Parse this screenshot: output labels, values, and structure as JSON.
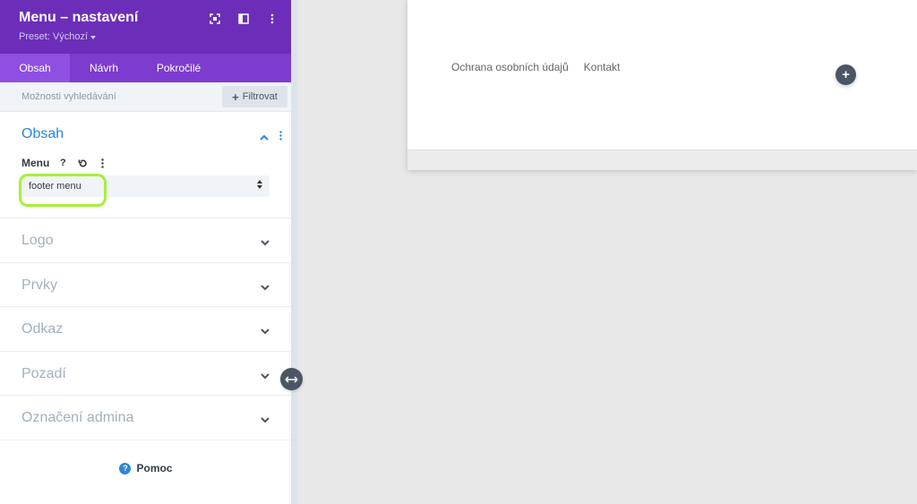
{
  "panel": {
    "title": "Menu – nastavení",
    "preset": "Preset: Výchozí",
    "header_icons": [
      "focus-icon",
      "sidebar-toggle-icon",
      "more-vertical-icon"
    ],
    "tabs": [
      {
        "label": "Obsah",
        "active": true
      },
      {
        "label": "Návrh",
        "active": false
      },
      {
        "label": "Pokročilé",
        "active": false
      }
    ],
    "search": {
      "placeholder": "Možnosti vyhledávání",
      "filter_label": "Filtrovat"
    },
    "open_section": {
      "title": "Obsah",
      "field_label": "Menu",
      "select_value": "footer menu"
    },
    "sections": [
      {
        "title": "Logo"
      },
      {
        "title": "Prvky"
      },
      {
        "title": "Odkaz"
      },
      {
        "title": "Pozadí"
      },
      {
        "title": "Označení admina"
      }
    ],
    "help_label": "Pomoc"
  },
  "canvas": {
    "menu_items": [
      "Ochrana osobních údajů",
      "Kontakt"
    ],
    "add_button": "+"
  },
  "colors": {
    "header": "#6c2eb9",
    "tabs": "#7d3bcf",
    "active_tab": "#8f4fe0",
    "accent_blue": "#2b87da",
    "highlight": "#a6ef3c"
  }
}
